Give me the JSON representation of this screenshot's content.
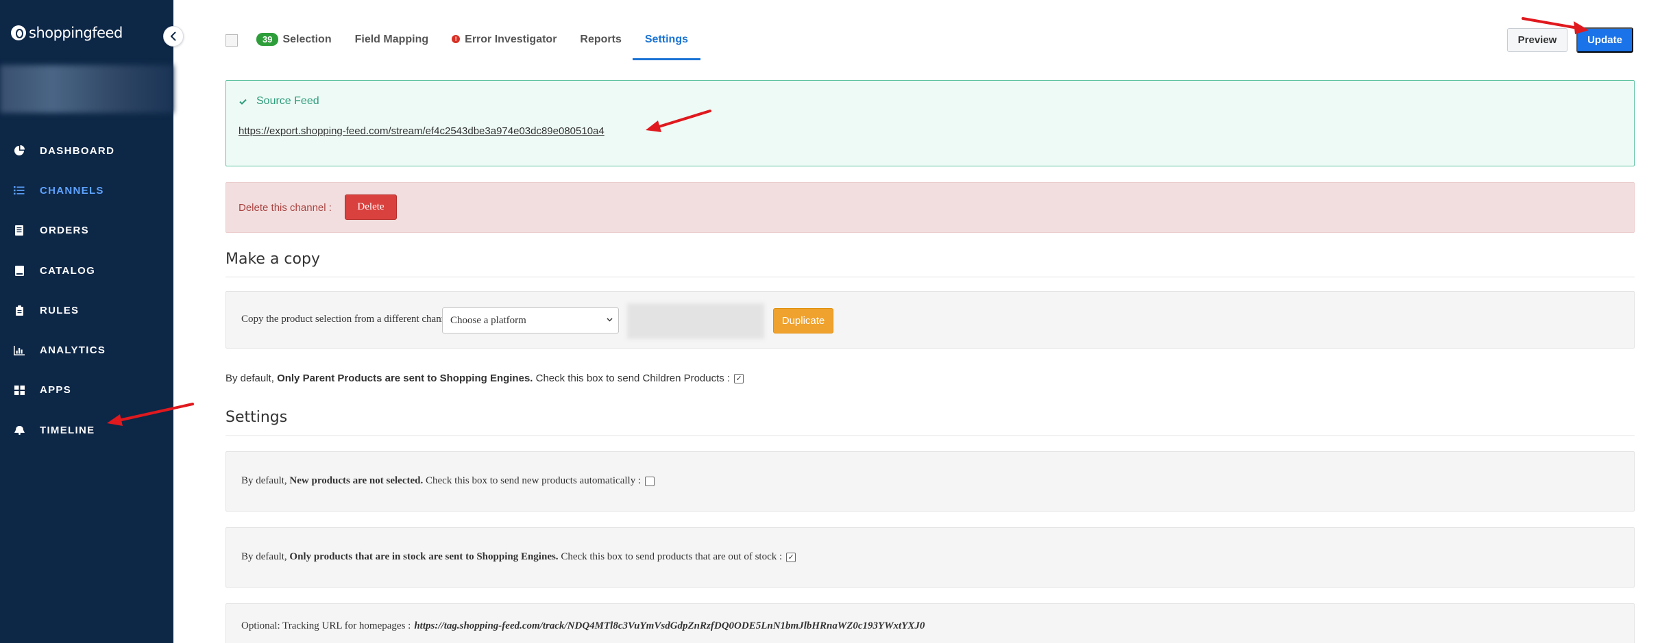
{
  "brand": {
    "name": "shoppingfeed"
  },
  "sidebar": {
    "items": [
      {
        "label": "DASHBOARD",
        "icon": "pie-chart-icon",
        "active": false
      },
      {
        "label": "CHANNELS",
        "icon": "list-icon",
        "active": true
      },
      {
        "label": "ORDERS",
        "icon": "receipt-icon",
        "active": false
      },
      {
        "label": "CATALOG",
        "icon": "book-icon",
        "active": false
      },
      {
        "label": "RULES",
        "icon": "clipboard-icon",
        "active": false
      },
      {
        "label": "ANALYTICS",
        "icon": "bar-chart-icon",
        "active": false
      },
      {
        "label": "APPS",
        "icon": "grid-icon",
        "active": false
      },
      {
        "label": "TIMELINE",
        "icon": "bell-icon",
        "active": false
      }
    ]
  },
  "tabs": {
    "selection_count": "39",
    "selection": "Selection",
    "field_mapping": "Field Mapping",
    "error_investigator": "Error Investigator",
    "reports": "Reports",
    "settings": "Settings"
  },
  "toolbar": {
    "preview": "Preview",
    "update": "Update"
  },
  "source_feed": {
    "title": "Source Feed",
    "url": "https://export.shopping-feed.com/stream/ef4c2543dbe3a974e03dc89e080510a4"
  },
  "delete": {
    "label": "Delete this channel :",
    "button": "Delete"
  },
  "copy": {
    "heading": "Make a copy",
    "label": "Copy the product selection from a different channel",
    "select_value": "Choose a platform",
    "button": "Duplicate"
  },
  "parent_products": {
    "prefix": "By default,",
    "bold": "Only Parent Products are sent to Shopping Engines.",
    "suffix": "Check this box to send Children Products :",
    "checked": true
  },
  "settings": {
    "heading": "Settings",
    "new_products": {
      "prefix": "By default,",
      "bold": "New products are not selected.",
      "suffix": "Check this box to send new products automatically :",
      "checked": false
    },
    "in_stock": {
      "prefix": "By default,",
      "bold": "Only products that are in stock are sent to Shopping Engines.",
      "suffix": "Check this box to send products that are out of stock :",
      "checked": true
    },
    "tracking": {
      "label": "Optional: Tracking URL for homepages :",
      "url": "https://tag.shopping-feed.com/track/NDQ4MTl8c3VuYmVsdGdpZnRzfDQ0ODE5LnN1bmJlbHRnaWZ0c193YWxtYXJ0"
    }
  },
  "colors": {
    "sidebar_bg": "#0d2747",
    "active_nav": "#5ea3ff",
    "primary": "#1a73e8",
    "success_border": "#5ec2a0",
    "danger_bg": "#f2dede",
    "danger_button": "#d9413e",
    "warning_button": "#f0a22e",
    "annotation_arrow": "#e0191e"
  }
}
